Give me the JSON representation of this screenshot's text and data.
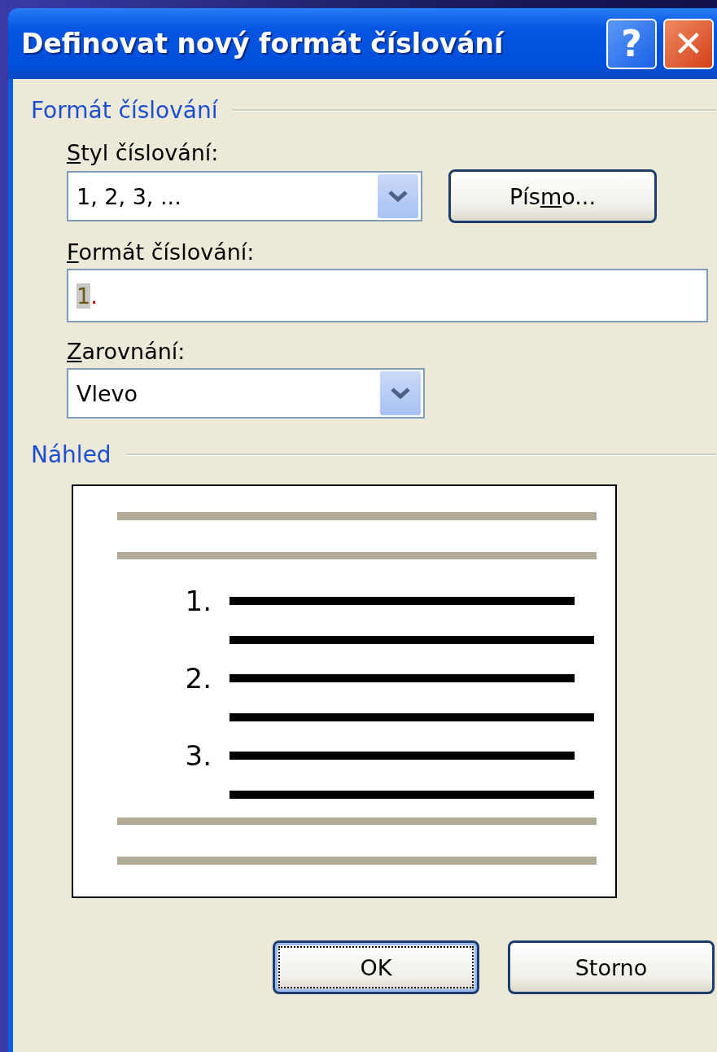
{
  "window": {
    "title": "Definovat nový formát číslování"
  },
  "title_buttons": [
    {
      "kind": "help",
      "label": "?"
    },
    {
      "kind": "close",
      "label": "✕"
    }
  ],
  "numbering_group": {
    "title": "Formát číslování",
    "style": {
      "label": {
        "key": "S",
        "after": "tyl číslování:"
      },
      "value": "1, 2, 3, ..."
    },
    "font_button": {
      "before": "Pís",
      "key": "m",
      "after": "o..."
    },
    "format": {
      "label": {
        "key": "F",
        "after": "ormát číslování:"
      },
      "value_parts": [
        {
          "kind": "field",
          "text": "1"
        },
        {
          "kind": "literal",
          "text": "."
        }
      ]
    },
    "alignment": {
      "label": {
        "key": "Z",
        "after": "arovnání:"
      },
      "value": "Vlevo"
    }
  },
  "preview_group": {
    "title": "Náhled",
    "items": [
      {
        "number": "1."
      },
      {
        "number": "2."
      },
      {
        "number": "3."
      }
    ]
  },
  "buttons": [
    {
      "label": "OK",
      "default": true
    },
    {
      "label": "Storno",
      "default": false
    }
  ]
}
